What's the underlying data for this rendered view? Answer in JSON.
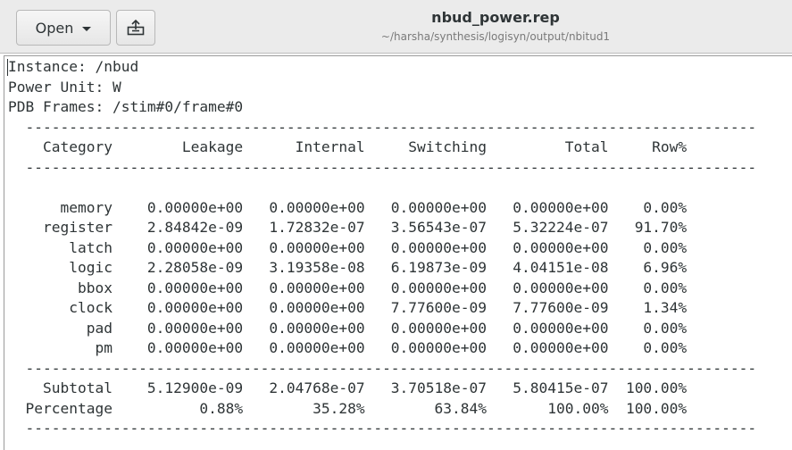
{
  "header": {
    "open_label": "Open",
    "title": "nbud_power.rep",
    "subtitle": "~/harsha/synthesis/logisyn/output/nbitud1"
  },
  "icons": {
    "open_dropdown": "chevron-down-icon",
    "save": "save-icon"
  },
  "report": {
    "instance_line": "Instance: /nbud",
    "unit_line": "Power Unit: W",
    "frames_line": "PDB Frames: /stim#0/frame#0",
    "columns": [
      "Category",
      "Leakage",
      "Internal",
      "Switching",
      "Total",
      "Row%"
    ],
    "rows": [
      [
        "memory",
        "0.00000e+00",
        "0.00000e+00",
        "0.00000e+00",
        "0.00000e+00",
        "0.00%"
      ],
      [
        "register",
        "2.84842e-09",
        "1.72832e-07",
        "3.56543e-07",
        "5.32224e-07",
        "91.70%"
      ],
      [
        "latch",
        "0.00000e+00",
        "0.00000e+00",
        "0.00000e+00",
        "0.00000e+00",
        "0.00%"
      ],
      [
        "logic",
        "2.28058e-09",
        "3.19358e-08",
        "6.19873e-09",
        "4.04151e-08",
        "6.96%"
      ],
      [
        "bbox",
        "0.00000e+00",
        "0.00000e+00",
        "0.00000e+00",
        "0.00000e+00",
        "0.00%"
      ],
      [
        "clock",
        "0.00000e+00",
        "0.00000e+00",
        "7.77600e-09",
        "7.77600e-09",
        "1.34%"
      ],
      [
        "pad",
        "0.00000e+00",
        "0.00000e+00",
        "0.00000e+00",
        "0.00000e+00",
        "0.00%"
      ],
      [
        "pm",
        "0.00000e+00",
        "0.00000e+00",
        "0.00000e+00",
        "0.00000e+00",
        "0.00%"
      ]
    ],
    "totals": [
      [
        "Subtotal",
        "5.12900e-09",
        "2.04768e-07",
        "3.70518e-07",
        "5.80415e-07",
        "100.00%"
      ],
      [
        "Percentage",
        "0.88%",
        "35.28%",
        "63.84%",
        "100.00%",
        "100.00%"
      ]
    ]
  }
}
